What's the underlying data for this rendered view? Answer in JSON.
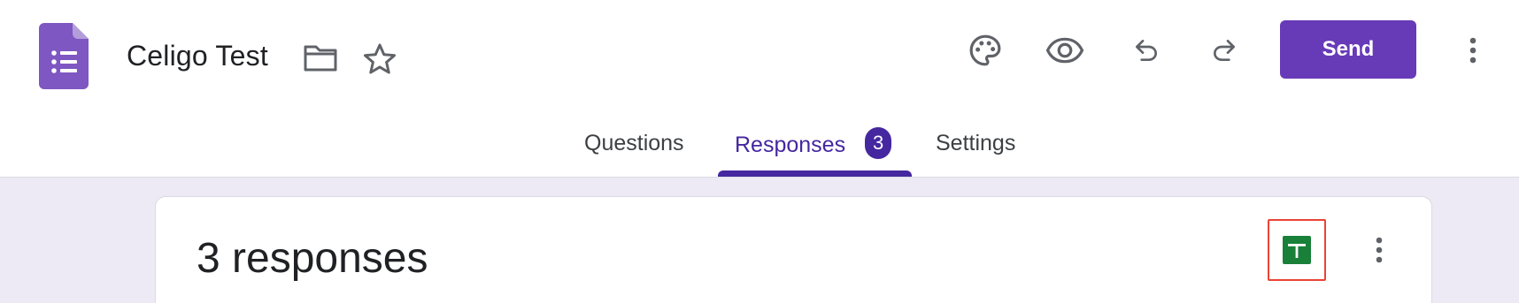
{
  "app": {
    "title": "Celigo Test",
    "logo_icon": "google-forms-icon",
    "brand_color": "#673ab7"
  },
  "header": {
    "icons": [
      "folder-icon",
      "star-icon",
      "palette-icon",
      "eye-icon",
      "undo-icon",
      "redo-icon",
      "more-vert-icon"
    ],
    "send_label": "Send"
  },
  "tabs": [
    {
      "label": "Questions",
      "active": false
    },
    {
      "label": "Responses",
      "active": true,
      "badge": "3"
    },
    {
      "label": "Settings",
      "active": false
    }
  ],
  "responses_card": {
    "title": "3 responses",
    "actions": [
      "google-sheets-icon",
      "more-vert-icon"
    ],
    "sheets_color": "#188038",
    "highlight_color": "#ea4335"
  }
}
